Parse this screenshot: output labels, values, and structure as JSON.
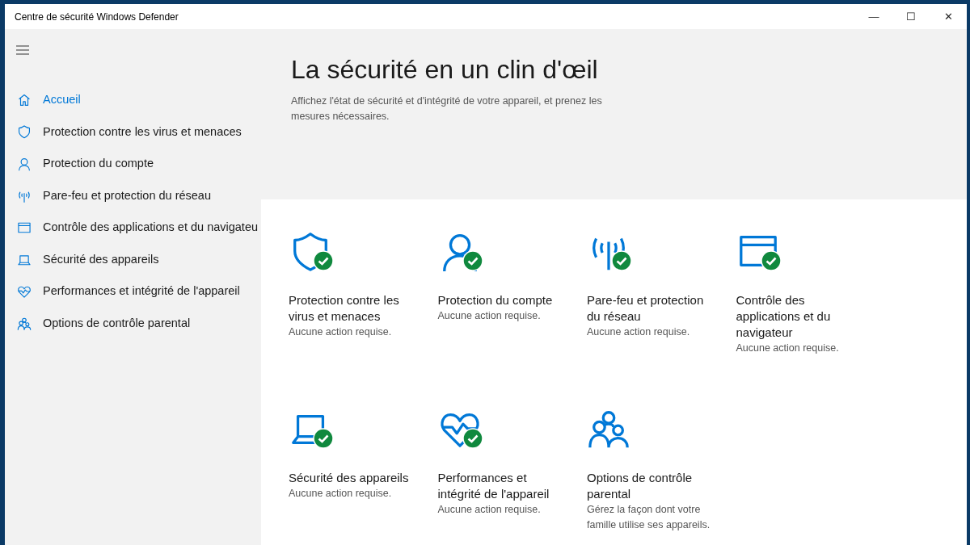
{
  "window": {
    "title": "Centre de sécurité Windows Defender",
    "controls": [
      "—",
      "☐",
      "✕"
    ]
  },
  "sidebar": {
    "items": [
      {
        "label": "Accueil",
        "kind": "home",
        "selected": true
      },
      {
        "label": "Protection contre les virus et menaces",
        "kind": "shield",
        "selected": false
      },
      {
        "label": "Protection du compte",
        "kind": "person",
        "selected": false
      },
      {
        "label": "Pare-feu et protection du réseau",
        "kind": "antenna",
        "selected": false
      },
      {
        "label": "Contrôle des applications et du navigateu",
        "kind": "browser",
        "selected": false
      },
      {
        "label": "Sécurité des appareils",
        "kind": "laptop",
        "selected": false
      },
      {
        "label": "Performances et intégrité de l'appareil",
        "kind": "heart",
        "selected": false
      },
      {
        "label": "Options de contrôle parental",
        "kind": "family",
        "selected": false
      }
    ]
  },
  "header": {
    "title": "La sécurité en un clin d'œil",
    "description": "Affichez l'état de sécurité et d'intégrité de votre appareil, et prenez les mesures nécessaires."
  },
  "tiles": [
    {
      "title": "Protection contre les virus et menaces",
      "status": "Aucune action requise.",
      "kind": "shield",
      "ok": true
    },
    {
      "title": "Protection du compte",
      "status": "Aucune action requise.",
      "kind": "person",
      "ok": true
    },
    {
      "title": "Pare-feu et protection du réseau",
      "status": "Aucune action requise.",
      "kind": "antenna",
      "ok": true
    },
    {
      "title": "Contrôle des applications et du navigateur",
      "status": "Aucune action requise.",
      "kind": "browser",
      "ok": true
    },
    {
      "title": "Sécurité des appareils",
      "status": "Aucune action requise.",
      "kind": "laptop",
      "ok": true
    },
    {
      "title": "Performances et intégrité de l'appareil",
      "status": "Aucune action requise.",
      "kind": "heart",
      "ok": true
    },
    {
      "title": "Options de contrôle parental",
      "status": "Gérez la façon dont votre famille utilise ses appareils.",
      "kind": "family",
      "ok": false
    }
  ]
}
